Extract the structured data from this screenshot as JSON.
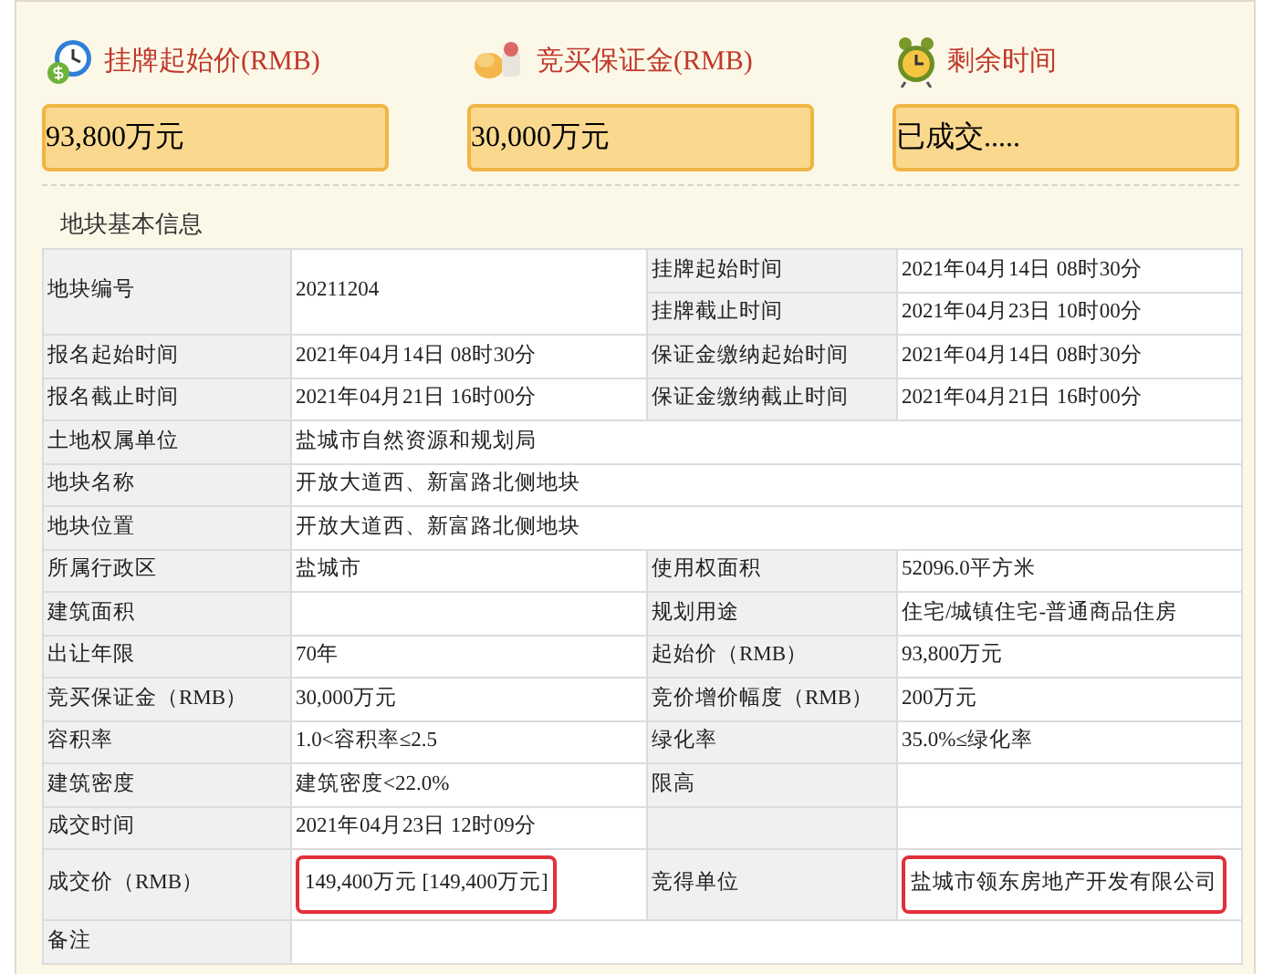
{
  "stats": [
    {
      "kind": "clock-coin",
      "label": "挂牌起始价(RMB)",
      "value": "93,800万元"
    },
    {
      "kind": "coins",
      "label": "竞买保证金(RMB)",
      "value": "30,000万元"
    },
    {
      "kind": "alarm-clock",
      "label": "剩余时间",
      "value": "已成交....."
    }
  ],
  "section_title": "地块基本信息",
  "rows": [
    {
      "kind": "split",
      "label": "地块编号",
      "value": "20211204",
      "sub": [
        {
          "label": "挂牌起始时间",
          "value": "2021年04月14日 08时30分"
        },
        {
          "label": "挂牌截止时间",
          "value": "2021年04月23日 10时00分"
        }
      ]
    },
    {
      "kind": "pair",
      "cells": [
        {
          "label": "报名起始时间",
          "value": "2021年04月14日 08时30分",
          "highlighted": false
        },
        {
          "label": "保证金缴纳起始时间",
          "value": "2021年04月14日 08时30分",
          "highlighted": false
        }
      ]
    },
    {
      "kind": "pair",
      "cells": [
        {
          "label": "报名截止时间",
          "value": "2021年04月21日 16时00分",
          "highlighted": false
        },
        {
          "label": "保证金缴纳截止时间",
          "value": "2021年04月21日 16时00分",
          "highlighted": false
        }
      ]
    },
    {
      "kind": "wide",
      "cells": [
        {
          "label": "土地权属单位",
          "value": "盐城市自然资源和规划局",
          "highlighted": false
        }
      ]
    },
    {
      "kind": "wide",
      "cells": [
        {
          "label": "地块名称",
          "value": "开放大道西、新富路北侧地块",
          "highlighted": false
        }
      ]
    },
    {
      "kind": "wide",
      "cells": [
        {
          "label": "地块位置",
          "value": "开放大道西、新富路北侧地块",
          "highlighted": false
        }
      ]
    },
    {
      "kind": "pair",
      "cells": [
        {
          "label": "所属行政区",
          "value": "盐城市",
          "highlighted": false
        },
        {
          "label": "使用权面积",
          "value": "52096.0平方米",
          "highlighted": false
        }
      ]
    },
    {
      "kind": "pair",
      "cells": [
        {
          "label": "建筑面积",
          "highlighted": false
        },
        {
          "label": "规划用途",
          "value": "住宅/城镇住宅-普通商品住房",
          "highlighted": false
        }
      ]
    },
    {
      "kind": "pair",
      "cells": [
        {
          "label": "出让年限",
          "value": "70年",
          "highlighted": false
        },
        {
          "label": "起始价（RMB）",
          "value": "93,800万元",
          "highlighted": false
        }
      ]
    },
    {
      "kind": "pair",
      "cells": [
        {
          "label": "竞买保证金（RMB）",
          "value": "30,000万元",
          "highlighted": false
        },
        {
          "label": "竞价增价幅度（RMB）",
          "value": "200万元",
          "highlighted": false
        }
      ]
    },
    {
      "kind": "pair",
      "cells": [
        {
          "label": "容积率",
          "value": "1.0<容积率≤2.5",
          "highlighted": false
        },
        {
          "label": "绿化率",
          "value": "35.0%≤绿化率",
          "highlighted": false
        }
      ]
    },
    {
      "kind": "pair",
      "cells": [
        {
          "label": "建筑密度",
          "value": "建筑密度<22.0%",
          "highlighted": false
        },
        {
          "label": "限高",
          "highlighted": false
        }
      ]
    },
    {
      "kind": "pair",
      "cells": [
        {
          "label": "成交时间",
          "value": "2021年04月23日 12时09分",
          "highlighted": false
        },
        {
          "highlighted": false
        }
      ]
    },
    {
      "kind": "pair",
      "cells": [
        {
          "label": "成交价（RMB）",
          "value": "149,400万元 [149,400万元]",
          "highlighted": true
        },
        {
          "label": "竞得单位",
          "value": "盐城市领东房地产开发有限公司",
          "highlighted": true
        }
      ]
    },
    {
      "kind": "wide",
      "cells": [
        {
          "label": "备注",
          "highlighted": false
        }
      ]
    }
  ]
}
